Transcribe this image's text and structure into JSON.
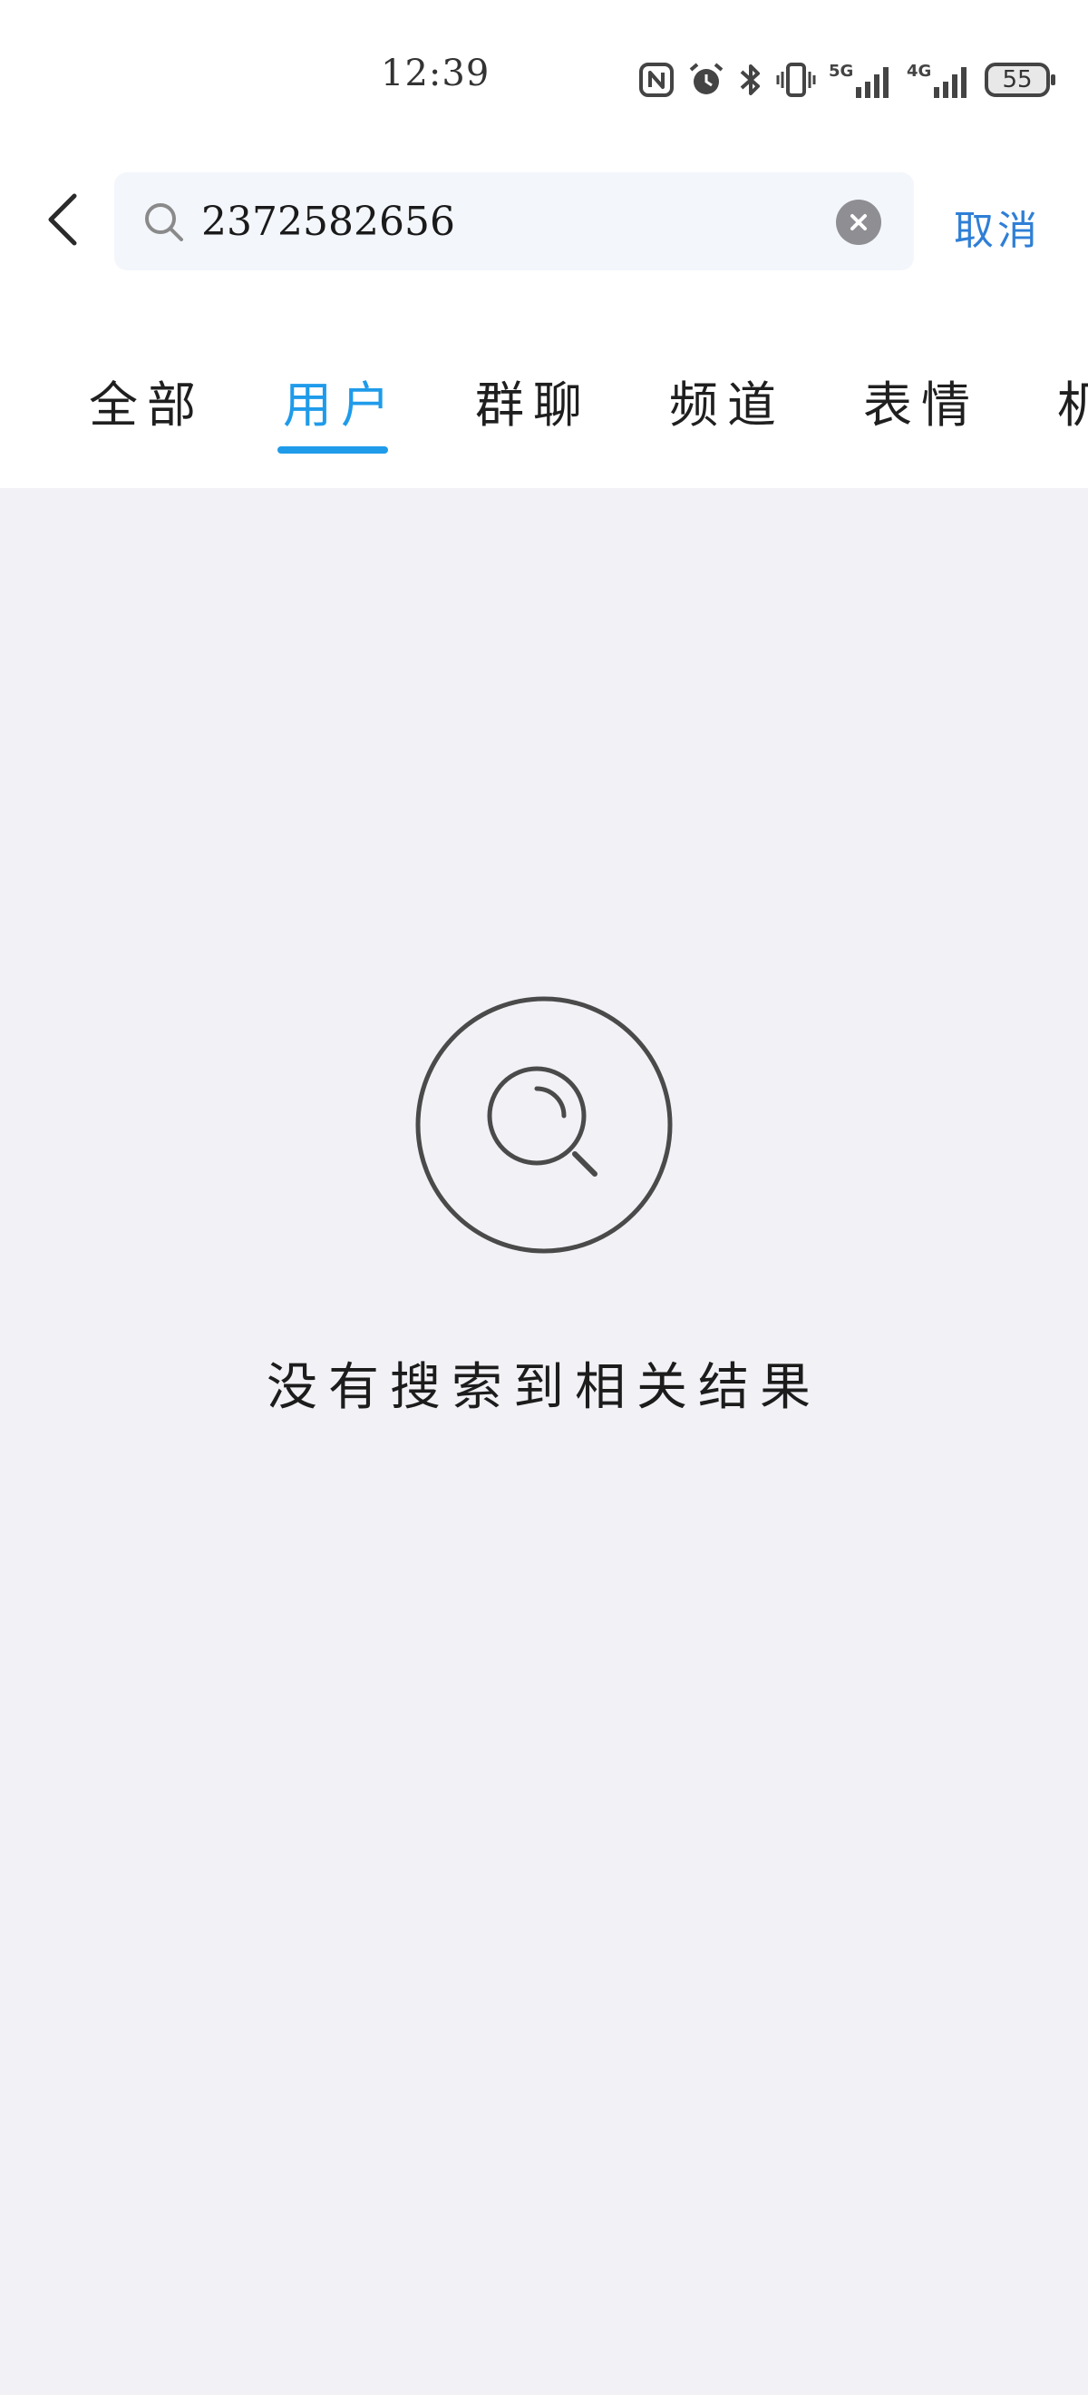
{
  "status_bar": {
    "time": "12:39",
    "icons": [
      "nfc-icon",
      "alarm-icon",
      "bluetooth-icon",
      "vibrate-icon",
      "signal-5g-icon",
      "signal-4g-icon"
    ],
    "network_5g": "5G",
    "network_4g": "4G",
    "battery": "55"
  },
  "search": {
    "query": "2372582656",
    "cancel_label": "取消"
  },
  "tabs": [
    {
      "label": "全部"
    },
    {
      "label": "用户"
    },
    {
      "label": "群聊"
    },
    {
      "label": "频道"
    },
    {
      "label": "表情"
    },
    {
      "label": "机"
    }
  ],
  "active_tab": "用户",
  "empty_state": {
    "message": "没有搜索到相关结果"
  },
  "colors": {
    "accent": "#1f9bea",
    "cancel": "#2f7fd6",
    "background": "#f1f1f6",
    "search_box": "#f3f6fb"
  }
}
